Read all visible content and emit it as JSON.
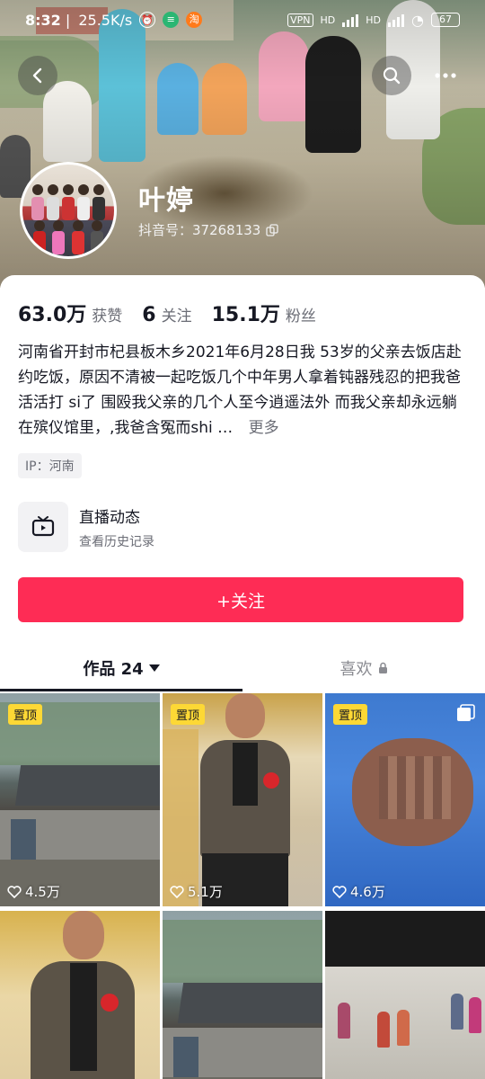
{
  "status_bar": {
    "time": "8:32",
    "net_speed": "25.5K/s",
    "hd1": "HD",
    "hd2": "HD",
    "vpn": "VPN",
    "battery": "67"
  },
  "profile": {
    "name": "叶婷",
    "douyin_id": "抖音号：37268133"
  },
  "stats": [
    {
      "num": "63.0万",
      "label": "获赞"
    },
    {
      "num": "6",
      "label": "关注"
    },
    {
      "num": "15.1万",
      "label": "粉丝"
    }
  ],
  "bio": {
    "text": "河南省开封市杞县板木乡2021年6月28日我 53岁的父亲去饭店赴约吃饭，原因不清被一起吃饭几个中年男人拿着钝器残忍的把我爸活活打 si了 围殴我父亲的几个人至今逍遥法外 而我父亲却永远躺在殡仪馆里，,我爸含冤而shi …",
    "more": "更多"
  },
  "ip": "IP：河南",
  "live": {
    "title": "直播动态",
    "subtitle": "查看历史记录"
  },
  "follow_button": "+关注",
  "tabs": {
    "works": "作品 24",
    "likes": "喜欢"
  },
  "pin_label": "置顶",
  "videos": [
    {
      "pinned": true,
      "likes": "4.5万"
    },
    {
      "pinned": true,
      "likes": "5.1万"
    },
    {
      "pinned": true,
      "likes": "4.6万"
    },
    {
      "pinned": false,
      "likes": ""
    },
    {
      "pinned": false,
      "likes": ""
    },
    {
      "pinned": false,
      "likes": ""
    }
  ],
  "colors": {
    "accent": "#fe2c55",
    "pin": "#fdd835",
    "text_primary": "#161823",
    "text_secondary": "#6b6d76"
  },
  "icons": [
    "back-icon",
    "search-icon",
    "more-icon",
    "tv-icon",
    "caret-down-icon",
    "lock-icon",
    "heart-icon",
    "copy-icon",
    "multi-image-icon"
  ]
}
